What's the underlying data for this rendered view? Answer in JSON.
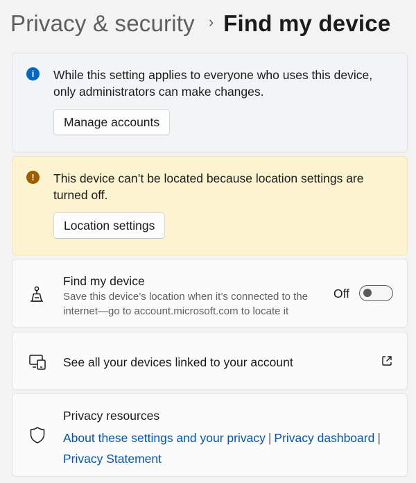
{
  "breadcrumb": {
    "parent": "Privacy & security",
    "separator": "›",
    "current": "Find my device"
  },
  "info_bar": {
    "icon": "info-icon",
    "icon_glyph": "i",
    "message": "While this setting applies to everyone who uses this device, only administrators can make changes.",
    "button_label": "Manage accounts"
  },
  "warning_bar": {
    "icon": "warning-icon",
    "icon_glyph": "!",
    "message": "This device can’t be located because location settings are turned off.",
    "button_label": "Location settings"
  },
  "find_my_device": {
    "title": "Find my device",
    "description": "Save this device’s location when it’s connected to the internet—go to account.microsoft.com to locate it",
    "toggle_state": "Off",
    "toggle_on": false
  },
  "linked_devices": {
    "label": "See all your devices linked to your account"
  },
  "privacy_resources": {
    "title": "Privacy resources",
    "links": [
      "About these settings and your privacy",
      "Privacy dashboard",
      "Privacy Statement"
    ],
    "separator": "|"
  },
  "colors": {
    "accent": "#0067c0",
    "link": "#0056b3",
    "warning_bg": "#fcf3d1",
    "warning_icon": "#9d5d00",
    "info_bg": "#f2f4f6"
  }
}
